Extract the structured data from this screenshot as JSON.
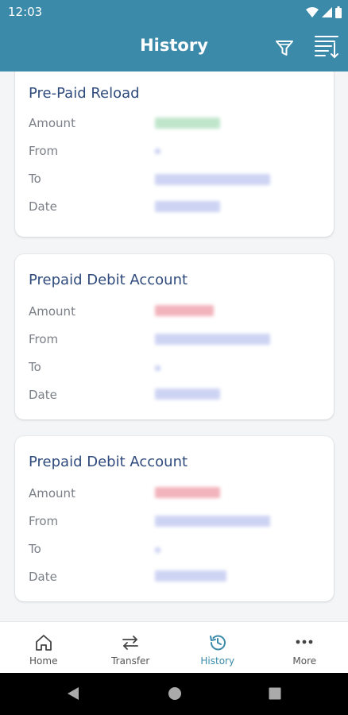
{
  "status_bar": {
    "time": "12:03"
  },
  "header": {
    "title": "History"
  },
  "cards": [
    {
      "title": "Pre-Paid Reload",
      "amount_label": "Amount",
      "from_label": "From",
      "to_label": "To",
      "date_label": "Date"
    },
    {
      "title": "Prepaid Debit Account",
      "amount_label": "Amount",
      "from_label": "From",
      "to_label": "To",
      "date_label": "Date"
    },
    {
      "title": "Prepaid Debit Account",
      "amount_label": "Amount",
      "from_label": "From",
      "to_label": "To",
      "date_label": "Date"
    }
  ],
  "bottom_nav": [
    {
      "label": "Home",
      "icon": "home-icon"
    },
    {
      "label": "Transfer",
      "icon": "transfer-icon"
    },
    {
      "label": "History",
      "icon": "history-icon",
      "active": true
    },
    {
      "label": "More",
      "icon": "more-icon"
    }
  ],
  "colors": {
    "header": "#3b8aaa",
    "card_title": "#2f4a7c",
    "active_nav": "#3b8aaa",
    "credit_amount": "#bfe5cb",
    "debit_amount": "#f2b3bc",
    "redacted_text": "#cdd3f3"
  }
}
